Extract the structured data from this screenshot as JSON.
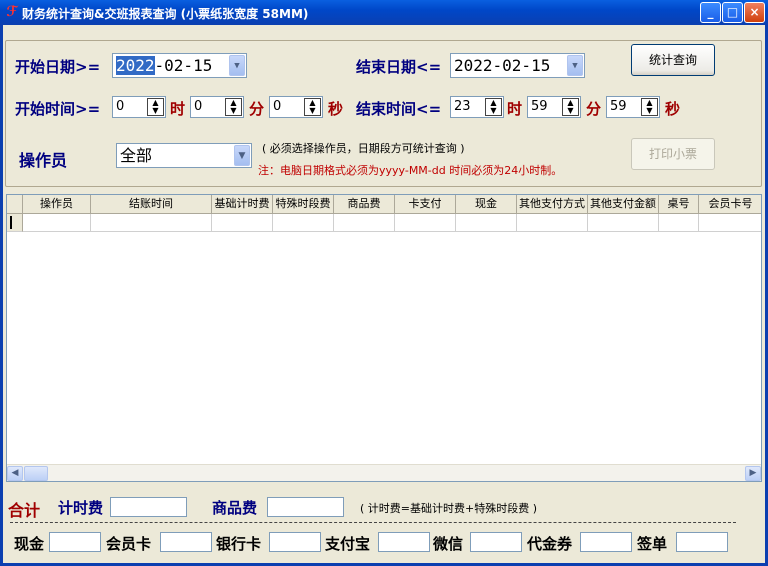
{
  "window": {
    "title": "财务统计查询&交班报表查询  (小票纸张宽度 58MM)",
    "minimize": "_",
    "maximize": "□",
    "close": "×"
  },
  "form": {
    "start_date_label": "开始日期>=",
    "start_date_selected": "2022",
    "start_date_rest": "-02-15",
    "end_date_label": "结束日期<=",
    "end_date_value": "2022-02-15",
    "start_time_label": "开始时间>=",
    "start_hour": "0",
    "start_minute": "0",
    "start_second": "0",
    "end_time_label": "结束时间<=",
    "end_hour": "23",
    "end_minute": "59",
    "end_second": "59",
    "hour_unit": "时",
    "minute_unit": "分",
    "second_unit": "秒",
    "operator_label": "操作员",
    "operator_value": "全部",
    "note1": "( 必须选择操作员，日期段方可统计查询 )",
    "note2": "注：电脑日期格式必须为yyyy-MM-dd 时间必须为24小时制。",
    "query_button": "统计查询",
    "print_button": "打印小票"
  },
  "table": {
    "columns": [
      "操作员",
      "结账时间",
      "基础计时费",
      "特殊时段费",
      "商品费",
      "卡支付",
      "现金",
      "其他支付方式",
      "其他支付金额",
      "桌号",
      "会员卡号"
    ]
  },
  "summary": {
    "total_label": "合计",
    "timing_fee_label": "计时费",
    "goods_fee_label": "商品费",
    "formula_note": "( 计时费=基础计时费+特殊时段费 )",
    "cash_label": "现金",
    "member_card_label": "会员卡",
    "bank_card_label": "银行卡",
    "alipay_label": "支付宝",
    "wechat_label": "微信",
    "voucher_label": "代金券",
    "sign_label": "签单"
  }
}
